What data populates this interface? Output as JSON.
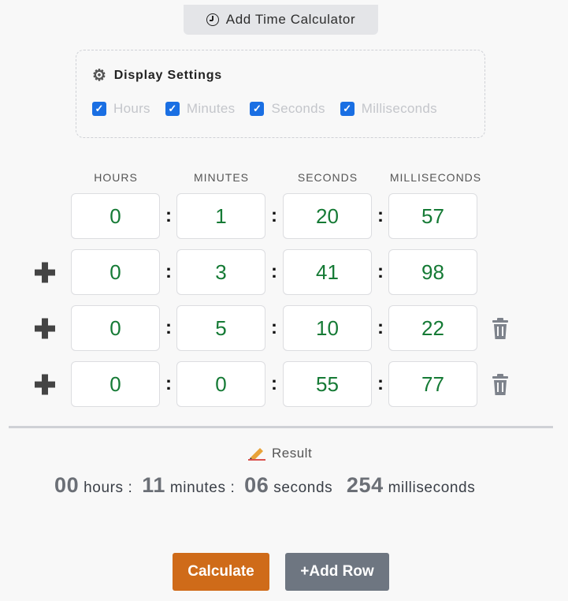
{
  "header": {
    "tab_label": "Add Time Calculator",
    "icon": "clock-icon"
  },
  "settings": {
    "title": "Display Settings",
    "icon": "gear-icon",
    "options": [
      {
        "label": "Hours",
        "checked": true
      },
      {
        "label": "Minutes",
        "checked": true
      },
      {
        "label": "Seconds",
        "checked": true
      },
      {
        "label": "Milliseconds",
        "checked": true
      }
    ]
  },
  "columns": [
    "HOURS",
    "MINUTES",
    "SECONDS",
    "MILLISECONDS"
  ],
  "separator": ":",
  "rows": [
    {
      "values": [
        "0",
        "1",
        "20",
        "57"
      ],
      "plus": false,
      "delete": false
    },
    {
      "values": [
        "0",
        "3",
        "41",
        "98"
      ],
      "plus": true,
      "delete": false
    },
    {
      "values": [
        "0",
        "5",
        "10",
        "22"
      ],
      "plus": true,
      "delete": true
    },
    {
      "values": [
        "0",
        "0",
        "55",
        "77"
      ],
      "plus": true,
      "delete": true
    }
  ],
  "result": {
    "label": "Result",
    "icon": "pencil-icon",
    "hours": "00",
    "hours_unit": "hours",
    "minutes": "11",
    "minutes_unit": "minutes",
    "seconds": "06",
    "seconds_unit": "seconds",
    "ms": "254",
    "ms_unit": "milliseconds",
    "sep": ":"
  },
  "buttons": {
    "calculate": "Calculate",
    "add_row": "+Add Row"
  },
  "colors": {
    "value_green": "#157a35",
    "calc_orange": "#cf6b19",
    "add_gray": "#6e7681",
    "check_blue": "#1a6fe3"
  }
}
